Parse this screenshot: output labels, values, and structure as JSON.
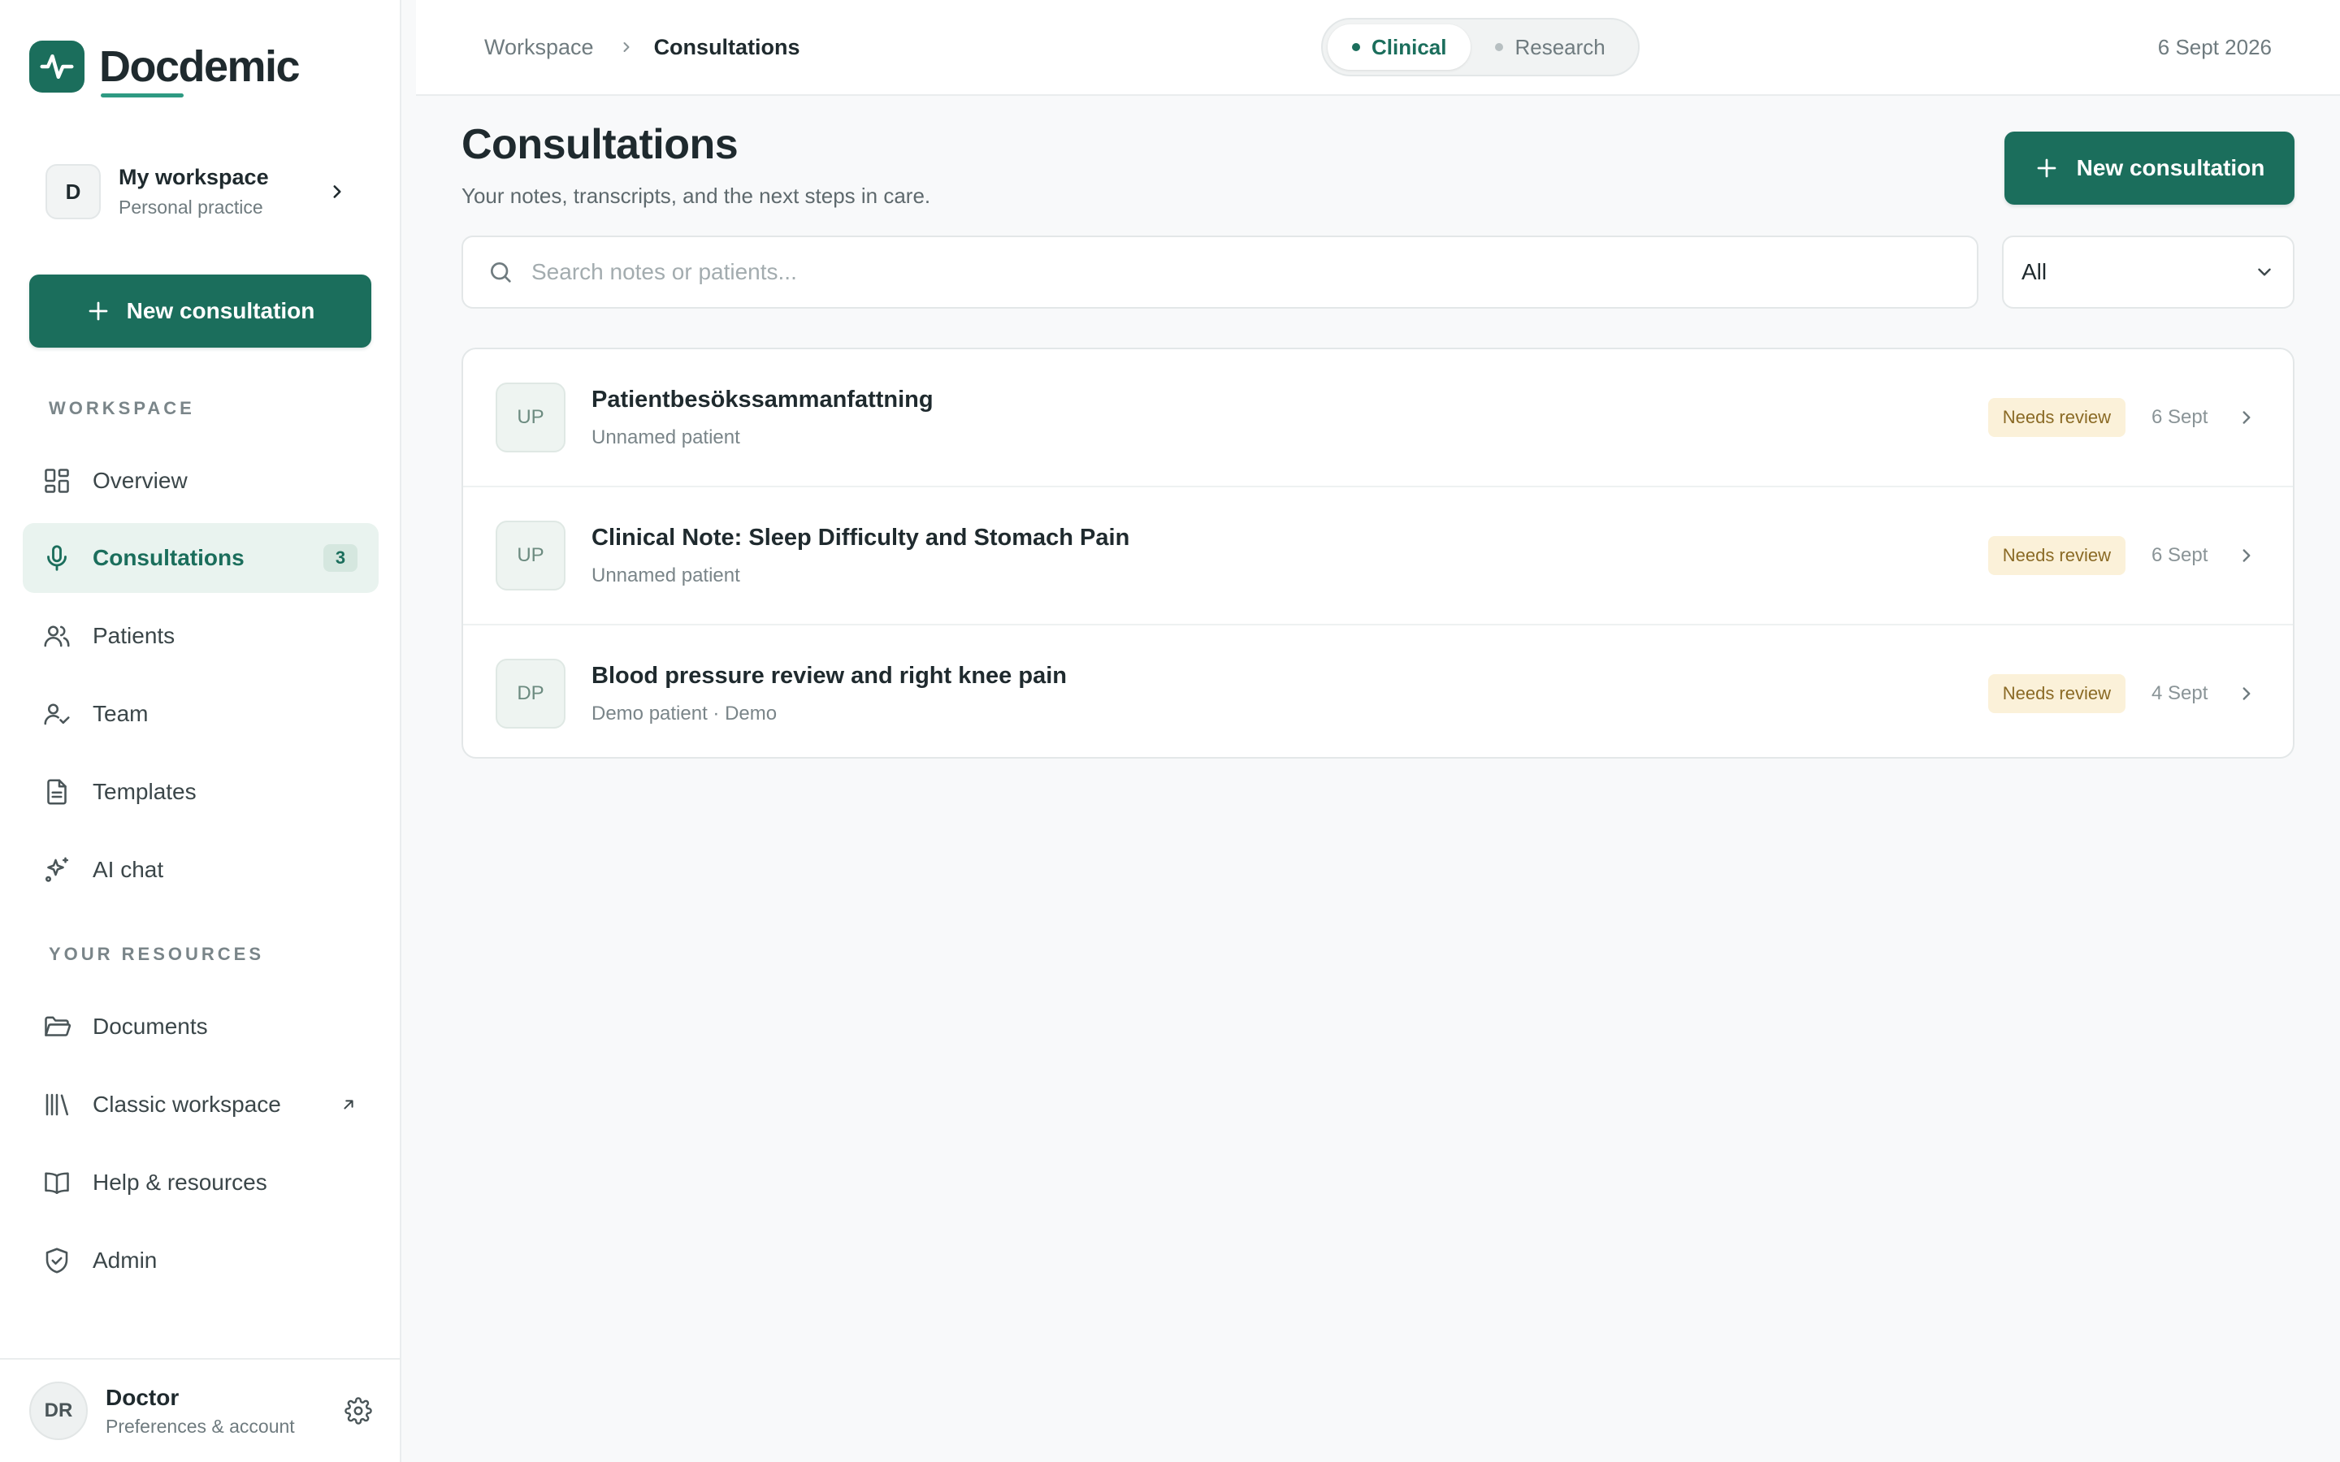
{
  "app": {
    "name": "Docdemic",
    "accent": "#1b6e5c"
  },
  "workspace": {
    "initial": "D",
    "name": "My workspace",
    "subtitle": "Personal practice"
  },
  "sidebar": {
    "new_button": "New consultation",
    "section_workspace": "WORKSPACE",
    "section_resources": "YOUR RESOURCES",
    "items": [
      {
        "label": "Overview",
        "icon": "grid-icon"
      },
      {
        "label": "Consultations",
        "icon": "microphone-icon",
        "badge": "3",
        "active": true
      },
      {
        "label": "Patients",
        "icon": "users-icon"
      },
      {
        "label": "Team",
        "icon": "user-check-icon"
      },
      {
        "label": "Templates",
        "icon": "document-icon"
      },
      {
        "label": "AI chat",
        "icon": "sparkles-icon"
      }
    ],
    "resources": [
      {
        "label": "Documents",
        "icon": "folder-icon"
      },
      {
        "label": "Classic workspace",
        "icon": "library-icon",
        "external": true
      },
      {
        "label": "Help & resources",
        "icon": "book-icon"
      },
      {
        "label": "Admin",
        "icon": "shield-check-icon"
      }
    ]
  },
  "profile": {
    "initials": "DR",
    "name": "Doctor",
    "subtitle": "Preferences & account"
  },
  "topbar": {
    "breadcrumb": [
      "Workspace",
      "Consultations"
    ],
    "modes": [
      "Clinical",
      "Research"
    ],
    "active_mode": "Clinical",
    "date": "6 Sept 2026"
  },
  "main": {
    "title": "Consultations",
    "subtitle": "Your notes, transcripts, and the next steps in care.",
    "new_button": "New consultation",
    "search_placeholder": "Search notes or patients...",
    "filter_value": "All",
    "consultations": [
      {
        "initials": "UP",
        "title": "Patientbesökssammanfattning",
        "subtitle": "Unnamed patient",
        "status": "Needs review",
        "date": "6 Sept"
      },
      {
        "initials": "UP",
        "title": "Clinical Note: Sleep Difficulty and Stomach Pain",
        "subtitle": "Unnamed patient",
        "status": "Needs review",
        "date": "6 Sept"
      },
      {
        "initials": "DP",
        "title": "Blood pressure review and right knee pain",
        "subtitle": "Demo patient · Demo",
        "status": "Needs review",
        "date": "4 Sept"
      }
    ]
  }
}
